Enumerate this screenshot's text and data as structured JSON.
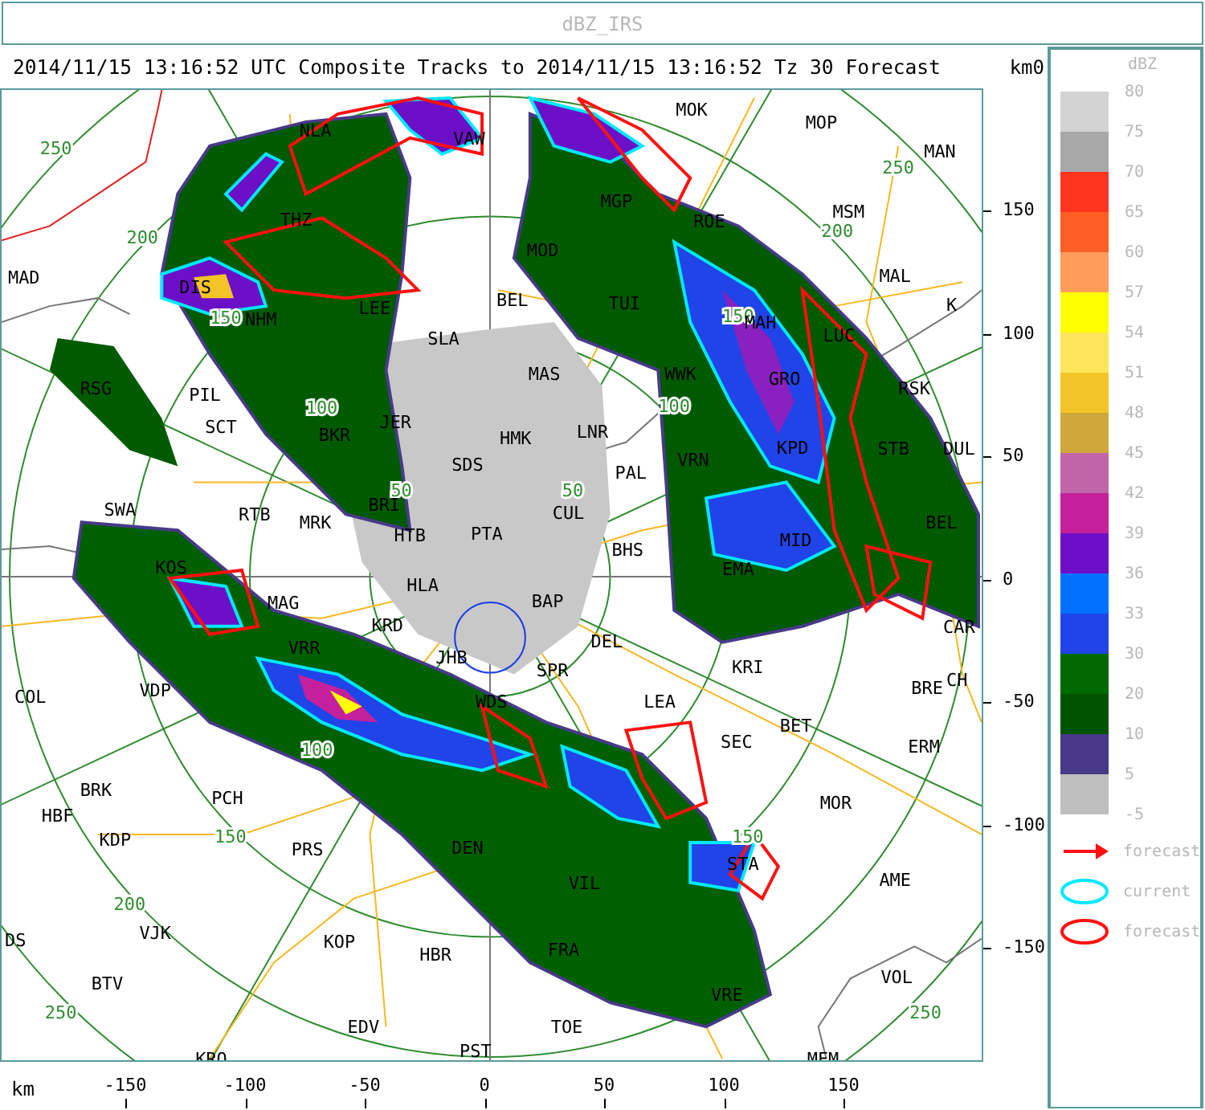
{
  "window": {
    "title": "dBZ_IRS"
  },
  "map": {
    "header": "2014/11/15 13:16:52 UTC Composite Tracks to 2014/11/15 13:16:52 Tz 30 Forecast",
    "y_axis_unit": "km",
    "y_axis_cut_label": "0",
    "x_axis_unit": "km",
    "x_ticks": [
      "-150",
      "-100",
      "-50",
      "0",
      "50",
      "100",
      "150"
    ],
    "y_ticks": [
      "150",
      "100",
      "50",
      "0",
      "-50",
      "-100",
      "-150"
    ],
    "range_labels": [
      "250",
      "200",
      "150",
      "100",
      "50",
      "50",
      "100",
      "150",
      "200",
      "250",
      "100",
      "150",
      "200",
      "250",
      "150",
      "250"
    ],
    "places": [
      "NLA",
      "VAW",
      "THZ",
      "MAD",
      "DIS",
      "NHM",
      "LEE",
      "SLA",
      "RSG",
      "PIL",
      "SCT",
      "BKR",
      "JER",
      "HMK",
      "SDS",
      "SWA",
      "RTB",
      "MRK",
      "BRI",
      "HTB",
      "PTA",
      "KOS",
      "HLA",
      "MAG",
      "KRD",
      "JHB",
      "VRR",
      "COL",
      "VDP",
      "WDS",
      "SPR",
      "BAP",
      "DEL",
      "LEA",
      "BHS",
      "CUL",
      "PAL",
      "LNR",
      "MAS",
      "BEL",
      "MOD",
      "MGP",
      "TUI",
      "MOK",
      "MOP",
      "MAN",
      "MSM",
      "ROE",
      "MAL",
      "K",
      "MAH",
      "LUC",
      "WWK",
      "GRO",
      "RSK",
      "KPD",
      "STB",
      "DUL",
      "VRN",
      "BEL",
      "MID",
      "EMA",
      "CAR",
      "BRE",
      "ERM",
      "CH",
      "KRI",
      "BET",
      "SEC",
      "MOR",
      "AME",
      "STA",
      "VOL",
      "VRE",
      "FRA",
      "TOE",
      "VIL",
      "DEN",
      "KRO",
      "EDV",
      "PST",
      "MFM",
      "HBR",
      "KOP",
      "VJK",
      "BTV",
      "DS",
      "KDP",
      "HBF",
      "BRK",
      "PCH",
      "PRS"
    ]
  },
  "legend": {
    "title": "dBZ",
    "last_label": "-5",
    "levels": [
      {
        "label": "80",
        "color": "#d3d3d3"
      },
      {
        "label": "75",
        "color": "#a8a8a8"
      },
      {
        "label": "70",
        "color": "#ff3520"
      },
      {
        "label": "65",
        "color": "#ff5e25"
      },
      {
        "label": "60",
        "color": "#ff9c5a"
      },
      {
        "label": "57",
        "color": "#ffff00"
      },
      {
        "label": "54",
        "color": "#ffe55a"
      },
      {
        "label": "51",
        "color": "#f3c428"
      },
      {
        "label": "48",
        "color": "#cfa83c"
      },
      {
        "label": "45",
        "color": "#c066a8"
      },
      {
        "label": "42",
        "color": "#c4209c"
      },
      {
        "label": "39",
        "color": "#6c10c8"
      },
      {
        "label": "36",
        "color": "#0070ff"
      },
      {
        "label": "33",
        "color": "#2044e8"
      },
      {
        "label": "30",
        "color": "#006a00"
      },
      {
        "label": "20",
        "color": "#005400"
      },
      {
        "label": "10",
        "color": "#483a88"
      },
      {
        "label": "5",
        "color": "#bebebe"
      }
    ],
    "keys": [
      {
        "kind": "arrow",
        "label": "forecast"
      },
      {
        "kind": "current",
        "label": "current"
      },
      {
        "kind": "forecast",
        "label": "forecast"
      }
    ]
  }
}
